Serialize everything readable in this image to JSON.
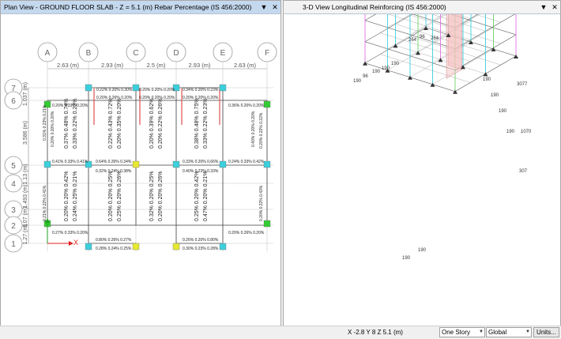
{
  "plan_view": {
    "title": "Plan View - GROUND FLOOR SLAB - Z = 5.1 (m)  Rebar Percentage  (IS 456:2000)",
    "dropdown_icon": "chevron-down-icon",
    "close_icon": "close-icon",
    "grid_columns": [
      "A",
      "B",
      "C",
      "D",
      "E",
      "F"
    ],
    "grid_rows": [
      "7",
      "6",
      "5",
      "4",
      "3",
      "2",
      "1"
    ],
    "column_spacings": [
      "2.63 (m)",
      "2.93 (m)",
      "2.5 (m)",
      "2.93 (m)",
      "2.63 (m)"
    ],
    "row_spacings": [
      "1.037 (m)",
      "3.586 (m)",
      "1.13 (m)",
      "1.493 (m)",
      "1.07 (m)",
      "1.27 (m)"
    ],
    "axis_x": "X",
    "axis_y": "Y",
    "slab_labels": {
      "r6_b": "0.22% 0.20% 0.30%",
      "r6_c": "0.20% 0.20% 0.20%",
      "r6_d": "0.34% 0.20% 0.23%",
      "r6b_b": "0.20% 0.26% 0.20%",
      "r6b_c": "0.20% 0.20% 0.20%",
      "r6b_d": "0.20% 0.20% 0.20%",
      "r5_b": "0.64% 0.26% 0.34%",
      "r5_d": "0.33% 0.20% 0.66%",
      "r5b_b": "0.32% 0.24% 0.38%",
      "r5b_d": "0.40% 0.23% 0.33%",
      "r5_a": "0.41% 0.33% 0.41%",
      "r5_e": "0.24% 0.33% 0.42%",
      "r6_a": "0.20% 0.33% 0.20%",
      "r6_e": "0.36% 0.20% 0.20%",
      "r1_b": "0.80% 0.26% 0.27%",
      "r1_d": "0.26% 0.20% 0.80%",
      "r1b_b": "0.28% 0.24% 0.25%",
      "r1b_d": "0.30% 0.23% 0.28%",
      "r2_a": "0.27% 0.33% 0.20%",
      "r2_e": "0.20% 0.26% 0.20%",
      "v_ab_top": "0.37% 0.48% 0.74%",
      "v_ab_top2": "0.33% 0.22% 0.23%",
      "v_bc_top": "0.22% 0.43% 0.72%",
      "v_bc_top2": "0.20% 0.35% 0.20%",
      "v_cd_top": "0.20% 0.39% 0.62%",
      "v_cd_top2": "0.20% 0.22% 0.26%",
      "v_de_top": "0.38% 0.48% 0.75%",
      "v_de_top2": "0.33% 0.22% 0.23%",
      "v_ab_bot": "0.20% 0.20% 0.42%",
      "v_ab_bot2": "0.24% 0.25% 0.21%",
      "v_bc_bot": "0.20% 0.20% 0.25%",
      "v_bc_bot2": "0.25% 0.20% 0.26%",
      "v_cd_bot": "0.32% 0.20% 0.25%",
      "v_cd_bot2": "0.20% 0.20% 0.26%",
      "v_de_bot": "0.25% 0.20% 0.42%",
      "v_de_bot2": "0.47% 0.20% 0.21%",
      "v_a_top": "0.31% 0.23% 0.21%",
      "v_f_top": "0.20% 0.22% 0.22%",
      "v_a_bot": "0.21% 0.22% 0.41%",
      "v_f_bot": "0.20% 0.22% 0.43%",
      "v_a_mid": "0.20% 0.20% 0.20%",
      "v_f_mid": "0.40% 0.20% 0.20%"
    }
  },
  "view_3d": {
    "title": "3-D View  Longitudinal Reinforcing  (IS 456:2000)",
    "dropdown_icon": "chevron-down-icon",
    "close_icon": "close-icon",
    "labels": [
      "264",
      "96",
      "264",
      "190",
      "96",
      "190",
      "190",
      "190",
      "190",
      "190",
      "190",
      "190",
      "3077",
      "1070",
      "307",
      "190",
      "190"
    ]
  },
  "status_bar": {
    "coordinates": "X -2.8  Y 8  Z 5.1 (m)",
    "story_option": "One Story",
    "coord_system": "Global",
    "units_button": "Units..."
  }
}
